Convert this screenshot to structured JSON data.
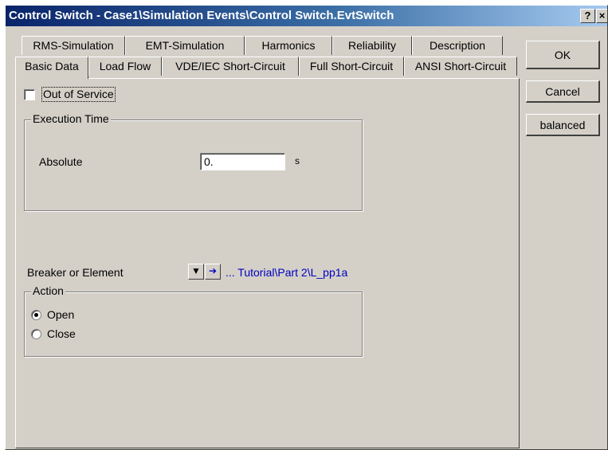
{
  "window": {
    "title": "Control Switch - Case1\\Simulation Events\\Control Switch.EvtSwitch",
    "help_label": "?",
    "close_label": "×"
  },
  "tabs_back": [
    "RMS-Simulation",
    "EMT-Simulation",
    "Harmonics",
    "Reliability",
    "Description"
  ],
  "tabs_front": [
    "Basic Data",
    "Load Flow",
    "VDE/IEC Short-Circuit",
    "Full Short-Circuit",
    "ANSI Short-Circuit"
  ],
  "active_tab": "Basic Data",
  "buttons": {
    "ok": "OK",
    "cancel": "Cancel",
    "balanced": "balanced"
  },
  "out_of_service": {
    "label": "Out of Service",
    "checked": false
  },
  "execution_time": {
    "group_label": "Execution Time",
    "absolute_label": "Absolute",
    "value": "0.",
    "unit": "s"
  },
  "breaker": {
    "label": "Breaker or Element",
    "dropdown_glyph": "▼",
    "jump_glyph": "➔",
    "value": "... Tutorial\\Part 2\\L_pp1a"
  },
  "action": {
    "group_label": "Action",
    "options": [
      "Open",
      "Close"
    ],
    "selected": "Open"
  }
}
